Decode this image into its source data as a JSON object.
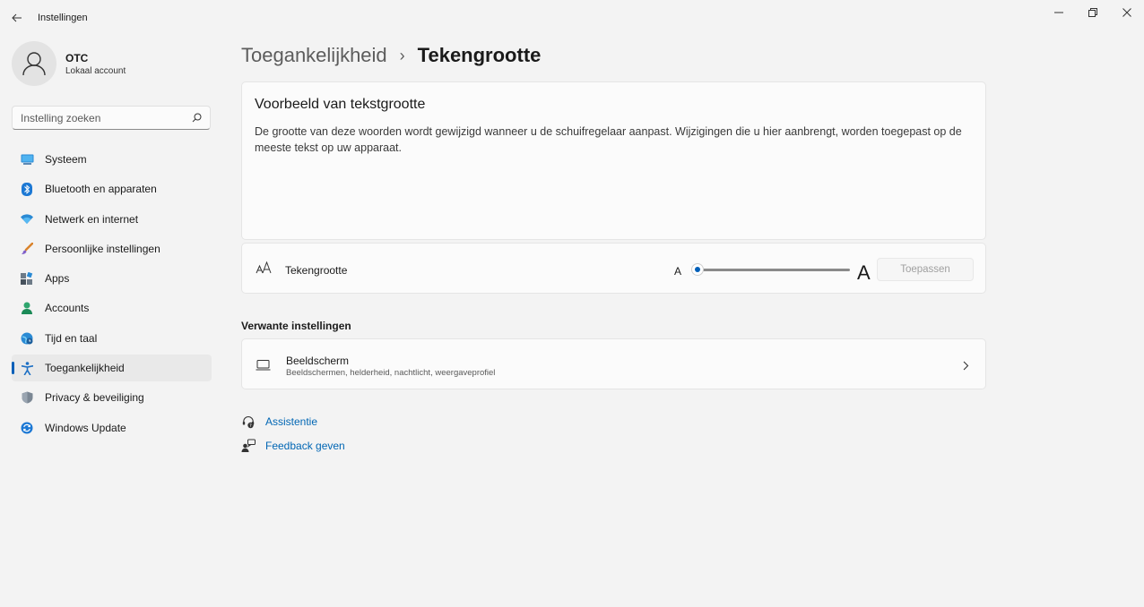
{
  "window": {
    "title": "Instellingen",
    "back_icon": "back-arrow-icon",
    "controls": [
      "minimize-icon",
      "restore-icon",
      "close-icon"
    ]
  },
  "profile": {
    "name": "OTC",
    "account_type": "Lokaal account"
  },
  "search": {
    "placeholder": "Instelling zoeken"
  },
  "sidebar": {
    "items": [
      {
        "label": "Systeem",
        "icon": "monitor-icon",
        "active": false
      },
      {
        "label": "Bluetooth en apparaten",
        "icon": "bluetooth-icon",
        "active": false
      },
      {
        "label": "Netwerk en internet",
        "icon": "wifi-icon",
        "active": false
      },
      {
        "label": "Persoonlijke instellingen",
        "icon": "brush-icon",
        "active": false
      },
      {
        "label": "Apps",
        "icon": "apps-icon",
        "active": false
      },
      {
        "label": "Accounts",
        "icon": "person-icon",
        "active": false
      },
      {
        "label": "Tijd en taal",
        "icon": "globe-clock-icon",
        "active": false
      },
      {
        "label": "Toegankelijkheid",
        "icon": "accessibility-icon",
        "active": true
      },
      {
        "label": "Privacy & beveiliging",
        "icon": "shield-icon",
        "active": false
      },
      {
        "label": "Windows Update",
        "icon": "update-icon",
        "active": false
      }
    ]
  },
  "breadcrumb": {
    "parent": "Toegankelijkheid",
    "separator": "›",
    "current": "Tekengrootte"
  },
  "preview": {
    "title": "Voorbeeld van tekstgrootte",
    "text": "De grootte van deze woorden wordt gewijzigd wanneer u de schuifregelaar aanpast. Wijzigingen die u hier aanbrengt, worden toegepast op de meeste tekst op uw apparaat."
  },
  "text_size": {
    "label": "Tekengrootte",
    "small_marker": "A",
    "large_marker": "A",
    "slider_value_fraction": 0,
    "apply_label": "Toepassen",
    "apply_enabled": false
  },
  "related": {
    "title": "Verwante instellingen",
    "display_title": "Beeldscherm",
    "display_subtitle": "Beeldschermen, helderheid, nachtlicht, weergaveprofiel"
  },
  "links": {
    "help": "Assistentie",
    "feedback": "Feedback geven"
  },
  "colors": {
    "accent": "#005fb8",
    "link": "#0066b4",
    "background": "#f3f3f3",
    "card": "#fbfbfb"
  }
}
